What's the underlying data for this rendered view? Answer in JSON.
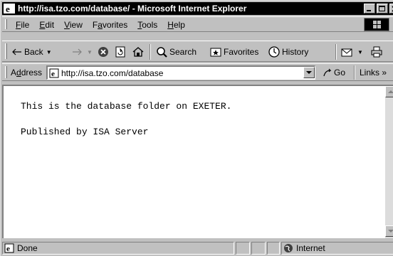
{
  "window": {
    "title": "http://isa.tzo.com/database/ - Microsoft Internet Explorer"
  },
  "menu": [
    {
      "key": "F",
      "rest": "ile"
    },
    {
      "key": "E",
      "rest": "dit"
    },
    {
      "key": "V",
      "rest": "iew"
    },
    {
      "pre": "F",
      "key": "a",
      "rest": "vorites"
    },
    {
      "key": "T",
      "rest": "ools"
    },
    {
      "key": "H",
      "rest": "elp"
    }
  ],
  "toolbar": {
    "back": "Back",
    "search": "Search",
    "favorites": "Favorites",
    "history": "History"
  },
  "address": {
    "label_key": "d",
    "label_pre": "A",
    "label_rest": "dress",
    "url": "http://isa.tzo.com/database",
    "go": "Go",
    "links": "Links »"
  },
  "page": {
    "lines": [
      "This is the database folder on EXETER.",
      "Published by ISA Server"
    ]
  },
  "status": {
    "text": "Done",
    "zone": "Internet"
  }
}
